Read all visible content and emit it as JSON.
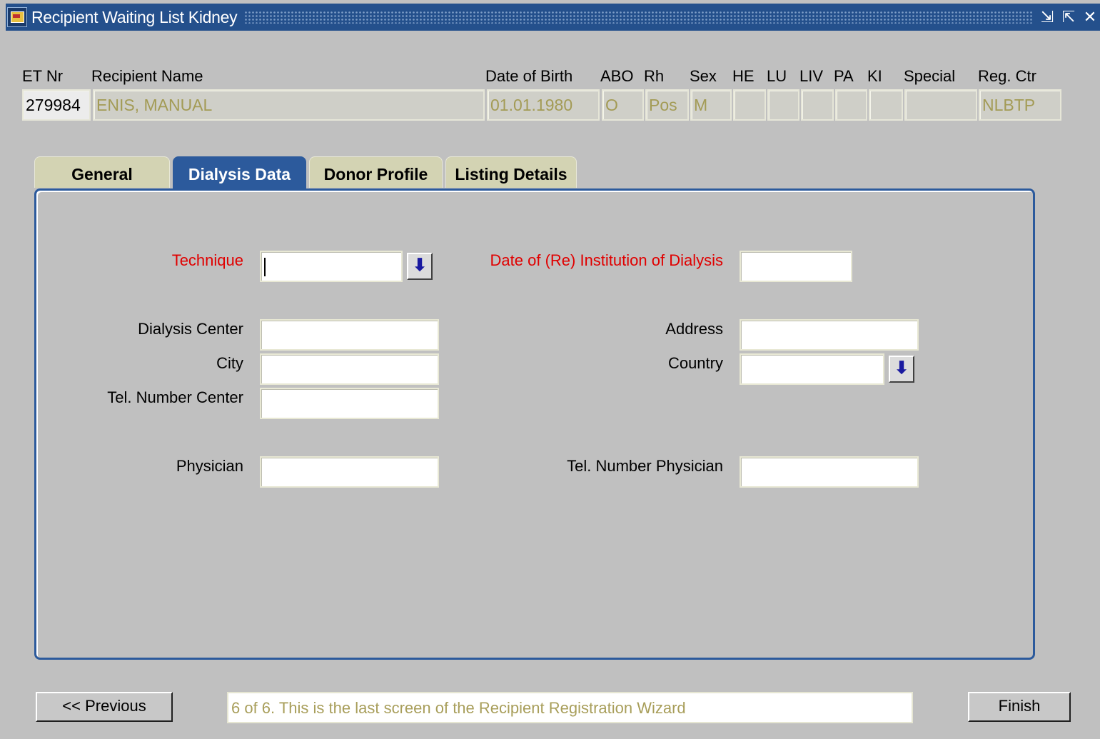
{
  "window": {
    "title": "Recipient Waiting List Kidney",
    "controls": [
      "⇲",
      "⇱",
      "✕"
    ]
  },
  "header": {
    "labels": {
      "et_nr": "ET Nr",
      "recipient_name": "Recipient Name",
      "date_of_birth": "Date of Birth",
      "abo": "ABO",
      "rh": "Rh",
      "sex": "Sex",
      "he": "HE",
      "lu": "LU",
      "liv": "LIV",
      "pa": "PA",
      "ki": "KI",
      "special": "Special",
      "reg_ctr": "Reg. Ctr"
    },
    "values": {
      "et_nr": "279984",
      "recipient_name": "ENIS, MANUAL",
      "date_of_birth": "01.01.1980",
      "abo": "O",
      "rh": "Pos",
      "sex": "M",
      "he": "",
      "lu": "",
      "liv": "",
      "pa": "",
      "ki": "",
      "special": "",
      "reg_ctr": "NLBTP"
    }
  },
  "tabs": {
    "general": "General",
    "dialysis": "Dialysis Data",
    "donor": "Donor Profile",
    "listing": "Listing Details",
    "active": "Dialysis Data"
  },
  "form": {
    "technique_label": "Technique",
    "technique_value": "",
    "date_institution_label": "Date of (Re) Institution of Dialysis",
    "date_institution_value": "",
    "dialysis_center_label": "Dialysis Center",
    "dialysis_center_value": "",
    "address_label": "Address",
    "address_value": "",
    "city_label": "City",
    "city_value": "",
    "country_label": "Country",
    "country_value": "",
    "tel_center_label": "Tel. Number Center",
    "tel_center_value": "",
    "physician_label": "Physician",
    "physician_value": "",
    "tel_physician_label": "Tel. Number Physician",
    "tel_physician_value": "",
    "lov_glyph": "⬇"
  },
  "footer": {
    "previous_label": "<< Previous",
    "status_text": "6 of 6. This is the last screen of the Recipient Registration Wizard",
    "finish_label": "Finish"
  },
  "colors": {
    "title_bar": "#24508c",
    "active_tab": "#2c5a9c",
    "required_label": "#e00000",
    "readonly_text": "#a39b55"
  },
  "icons": {
    "app": "oracle-forms-app-icon",
    "list_of_values": "down-arrow-icon"
  }
}
